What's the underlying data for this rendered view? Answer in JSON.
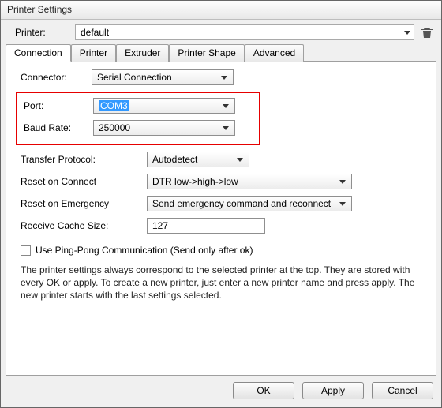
{
  "window": {
    "title": "Printer Settings"
  },
  "header": {
    "printer_label": "Printer:",
    "printer_value": "default"
  },
  "tabs": {
    "connection": "Connection",
    "printer": "Printer",
    "extruder": "Extruder",
    "printer_shape": "Printer Shape",
    "advanced": "Advanced"
  },
  "connection": {
    "connector_label": "Connector:",
    "connector_value": "Serial Connection",
    "port_label": "Port:",
    "port_value": "COM3",
    "baud_label": "Baud Rate:",
    "baud_value": "250000",
    "transfer_label": "Transfer Protocol:",
    "transfer_value": "Autodetect",
    "reset_connect_label": "Reset on Connect",
    "reset_connect_value": "DTR low->high->low",
    "reset_emerg_label": "Reset on Emergency",
    "reset_emerg_value": "Send emergency command and reconnect",
    "cache_label": "Receive Cache Size:",
    "cache_value": "127",
    "pingpong_label": "Use Ping-Pong Communication (Send only after ok)",
    "info_text": "The printer settings always correspond to the selected printer at the top. They are stored with every OK or apply. To create a new printer, just enter a new printer name and press apply. The new printer starts with the last settings selected."
  },
  "buttons": {
    "ok": "OK",
    "apply": "Apply",
    "cancel": "Cancel"
  }
}
